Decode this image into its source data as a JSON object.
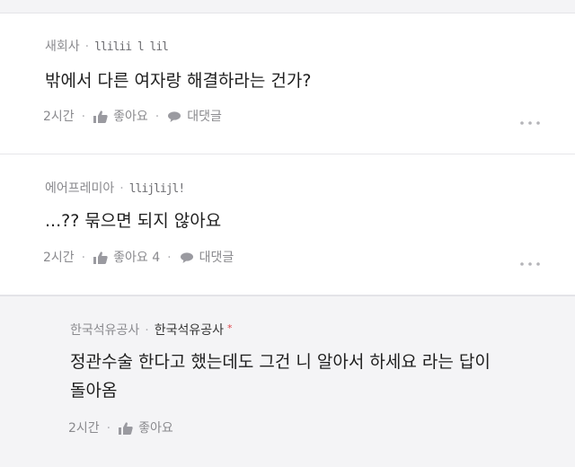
{
  "comments": [
    {
      "author": "새회사",
      "handle": "llilii l lil",
      "body": "밖에서 다른 여자랑 해결하라는 건가?",
      "time": "2시간",
      "like_label": "좋아요",
      "reply_label": "대댓글"
    },
    {
      "author": "에어프레미아",
      "handle": "llijlijl!",
      "body": "...?? 묶으면 되지 않아요",
      "time": "2시간",
      "like_label": "좋아요 4",
      "reply_label": "대댓글"
    }
  ],
  "reply": {
    "author": "한국석유공사",
    "author_badge": "한국석유공사",
    "badge_star": "*",
    "body_line1": "정관수술 한다고 했는데도 그건 니 알아서 하세요 라는 답이",
    "body_line2": "돌아옴",
    "time": "2시간",
    "like_label": "좋아요"
  },
  "separator_dot": "·",
  "icons": {
    "like": "thumbs-up-icon",
    "reply": "speech-bubble-icon",
    "more": "more-dots-icon"
  },
  "colors": {
    "meta_text": "#8a8a8e",
    "body_text": "#1e1e1e",
    "reply_background": "#f4f4f6",
    "badge_star": "#e0474c"
  }
}
